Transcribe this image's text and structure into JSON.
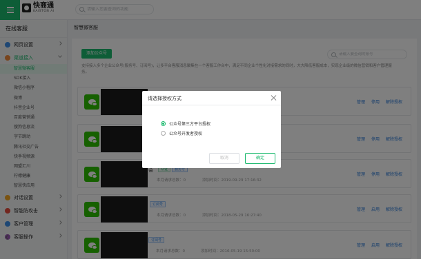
{
  "app": {
    "name": "快商通",
    "sub": "KAISTON AI"
  },
  "search": {
    "placeholder": "请输入您要查询的功能"
  },
  "sidebar": {
    "title": "在线客服",
    "groups_top": [
      {
        "label": "网页设置",
        "icon": "webpage-icon",
        "color": "#3d8ee9"
      },
      {
        "label": "渠道接入",
        "icon": "channel-icon",
        "color": "#f08a3c"
      }
    ],
    "sub_items": [
      "智慧微客服",
      "SDK接入",
      "微信小程序",
      "微博",
      "抖音企业号",
      "百度营销通",
      "搜狗信息流",
      "字节跳动",
      "腾讯社交广告",
      "快手视频源",
      "网盟汇川",
      "柠檬健康",
      "智慧快应用"
    ],
    "groups_bottom": [
      {
        "label": "对话设置",
        "icon": "dialog-icon",
        "color": "#f5a623"
      },
      {
        "label": "智能防攻击",
        "icon": "shield-icon",
        "color": "#e74c3c"
      },
      {
        "label": "客户管理",
        "icon": "user-icon",
        "color": "#3d8ee9"
      },
      {
        "label": "客服操作",
        "icon": "agent-icon",
        "color": "#9b59b6"
      }
    ]
  },
  "main": {
    "title": "智慧微客服",
    "add_button": "添加公众号",
    "account_search_placeholder": "请输入要查询的账号",
    "description": "支持接入多个企业公众号(服务号、订阅号)，让多平台客服消息聚集在一个客服工作台中，满足不同企业个性化对接需求的同时，大大降低客服成本，实现企业级的微信营销和客户管理服务。",
    "accounts": [
      {
        "tags": [],
        "total_label": "",
        "added": "",
        "actions": [
          "管理",
          "停用",
          "解除授权"
        ]
      },
      {
        "tags": [],
        "total_label": "",
        "added": "",
        "actions": [
          "管理",
          "停用",
          "解除授权"
        ]
      },
      {
        "tags": [
          "认证",
          "服务号"
        ],
        "name_suffix": "会",
        "total_label": "本月请求总数：0",
        "added": "添加时间：2019-09-29 17:16:32",
        "actions": [
          "管理",
          "停用",
          "解除授权"
        ]
      },
      {
        "tags": [
          "订阅号"
        ],
        "total_label": "本月请求总数：0",
        "added": "添加时间：2018-05-29 16:27:40",
        "actions": [
          "管理",
          "启用",
          "解除授权"
        ]
      },
      {
        "tags": [
          "订阅号"
        ],
        "total_label": "本月请求总数：0",
        "added": "添加时间：2016-05-19 15:50:00",
        "actions": [
          "管理",
          "启用",
          "解除授权"
        ]
      }
    ]
  },
  "dialog": {
    "title": "请选择授权方式",
    "options": [
      "公众号第三方平台授权",
      "公众号开发者授权"
    ],
    "selected": 0,
    "cancel": "取消",
    "confirm": "确定"
  }
}
